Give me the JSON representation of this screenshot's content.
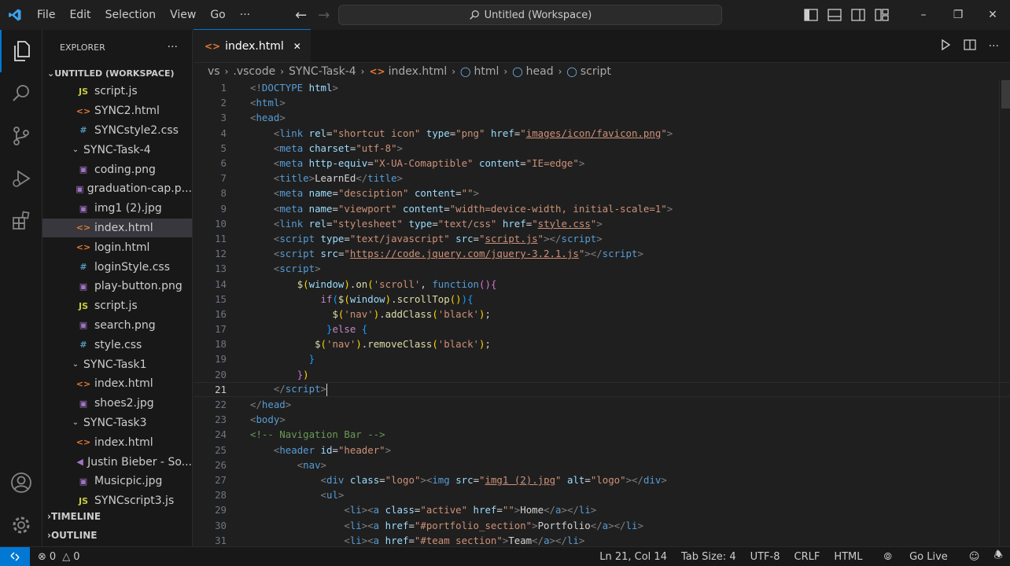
{
  "titlebar": {
    "menu": [
      "File",
      "Edit",
      "Selection",
      "View",
      "Go",
      "···"
    ],
    "command_center": "Untitled (Workspace)"
  },
  "sidebar": {
    "title": "EXPLORER",
    "more": "···",
    "workspace": "UNTITLED (WORKSPACE)",
    "items": [
      {
        "label": "script.js",
        "type": "js",
        "indent": 1
      },
      {
        "label": "SYNC2.html",
        "type": "html",
        "indent": 1
      },
      {
        "label": "SYNCstyle2.css",
        "type": "css",
        "indent": 1
      },
      {
        "label": "SYNC-Task-4",
        "type": "folder",
        "indent": 0
      },
      {
        "label": "coding.png",
        "type": "img",
        "indent": 1
      },
      {
        "label": "graduation-cap.p...",
        "type": "img",
        "indent": 1
      },
      {
        "label": "img1 (2).jpg",
        "type": "img",
        "indent": 1
      },
      {
        "label": "index.html",
        "type": "html",
        "indent": 1,
        "selected": true
      },
      {
        "label": "login.html",
        "type": "html",
        "indent": 1
      },
      {
        "label": "loginStyle.css",
        "type": "css",
        "indent": 1
      },
      {
        "label": "play-button.png",
        "type": "img",
        "indent": 1
      },
      {
        "label": "script.js",
        "type": "js",
        "indent": 1
      },
      {
        "label": "search.png",
        "type": "img",
        "indent": 1
      },
      {
        "label": "style.css",
        "type": "css",
        "indent": 1
      },
      {
        "label": "SYNC-Task1",
        "type": "folder",
        "indent": 0
      },
      {
        "label": "index.html",
        "type": "html",
        "indent": 1
      },
      {
        "label": "shoes2.jpg",
        "type": "img",
        "indent": 1
      },
      {
        "label": "SYNC-Task3",
        "type": "folder",
        "indent": 0
      },
      {
        "label": "index.html",
        "type": "html",
        "indent": 1
      },
      {
        "label": "Justin Bieber - So...",
        "type": "audio",
        "indent": 1
      },
      {
        "label": "Musicpic.jpg",
        "type": "img",
        "indent": 1
      },
      {
        "label": "SYNCscript3.js",
        "type": "js",
        "indent": 1
      }
    ],
    "timeline": "TIMELINE",
    "outline": "OUTLINE"
  },
  "tab": {
    "label": "index.html",
    "close": "✕"
  },
  "breadcrumb": [
    "vs",
    ".vscode",
    "SYNC-Task-4",
    "index.html",
    "html",
    "head",
    "script"
  ],
  "code": {
    "line_numbers": [
      "1",
      "2",
      "3",
      "4",
      "5",
      "6",
      "7",
      "8",
      "9",
      "10",
      "11",
      "12",
      "13",
      "14",
      "15",
      "16",
      "17",
      "18",
      "19",
      "20",
      "21",
      "22",
      "23",
      "24",
      "25",
      "26",
      "27",
      "28",
      "29",
      "30",
      "31"
    ],
    "current_line": 21
  },
  "status": {
    "errors": "0",
    "warnings": "0",
    "position": "Ln 21, Col 14",
    "tab_size": "Tab Size: 4",
    "encoding": "UTF-8",
    "eol": "CRLF",
    "language": "HTML",
    "golive": "Go Live"
  },
  "colors": {
    "accent": "#0078d4",
    "background": "#1f1f1f",
    "sidebar": "#181818"
  }
}
